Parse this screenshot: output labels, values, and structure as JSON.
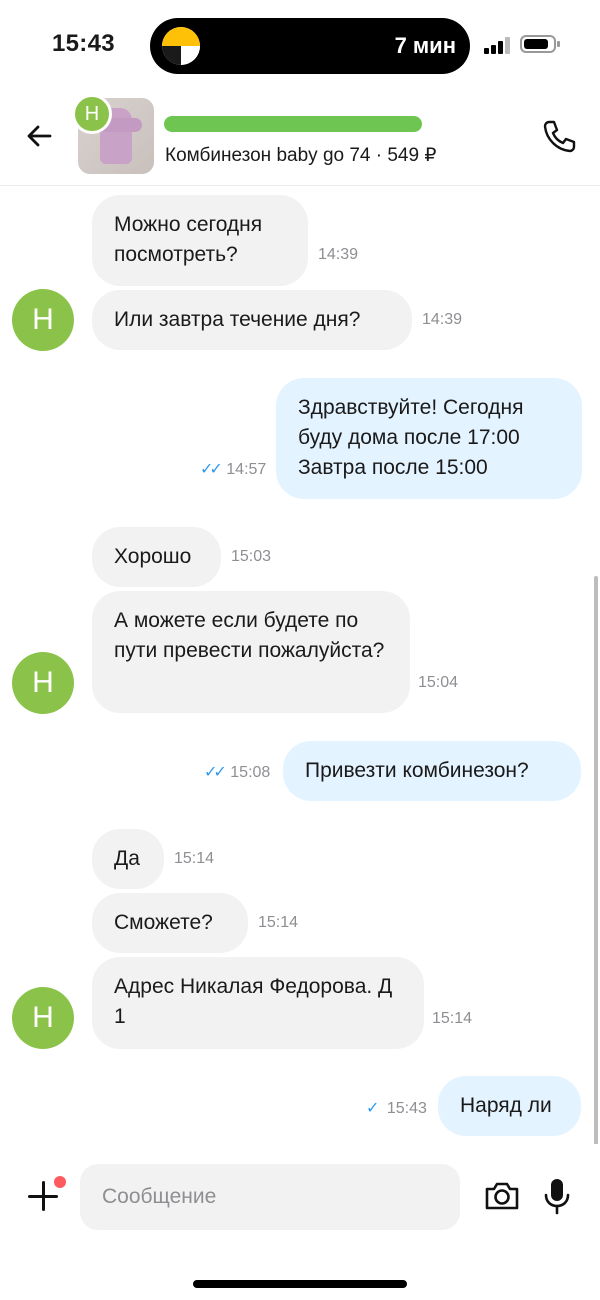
{
  "status_bar": {
    "time": "15:43",
    "island_text": "7 мин"
  },
  "header": {
    "avatar_letter": "Н",
    "product_line": "Комбинезон baby go 74 · 549 ₽"
  },
  "messages": [
    {
      "text": "Можно сегодня посмотреть?",
      "time": "14:39",
      "direction": "in"
    },
    {
      "text": "Или завтра течение дня?",
      "time": "14:39",
      "direction": "in"
    },
    {
      "text": "Здравствуйте! Сегодня буду дома после 17:00 Завтра после 15:00",
      "time": "14:57",
      "direction": "out",
      "status": "read"
    },
    {
      "text": "Хорошо",
      "time": "15:03",
      "direction": "in"
    },
    {
      "text": "А можете если будете по пути превести пожалуйста?",
      "time": "15:04",
      "direction": "in"
    },
    {
      "text": "Привезти комбинезон?",
      "time": "15:08",
      "direction": "out",
      "status": "read"
    },
    {
      "text": "Да",
      "time": "15:14",
      "direction": "in"
    },
    {
      "text": "Сможете?",
      "time": "15:14",
      "direction": "in"
    },
    {
      "text": "Адрес Никалая Федорова. Д 1",
      "time": "15:14",
      "direction": "in"
    },
    {
      "text": "Наряд ли",
      "time": "15:43",
      "direction": "out",
      "status": "sent"
    }
  ],
  "sender_avatar_letter": "Н",
  "composer": {
    "placeholder": "Сообщение"
  },
  "colors": {
    "avatar": "#8bc34a",
    "incoming_bubble": "#f2f2f2",
    "outgoing_bubble": "#e3f3ff",
    "read_ticks": "#2e9bf0",
    "notification_dot": "#ff5a5f"
  }
}
